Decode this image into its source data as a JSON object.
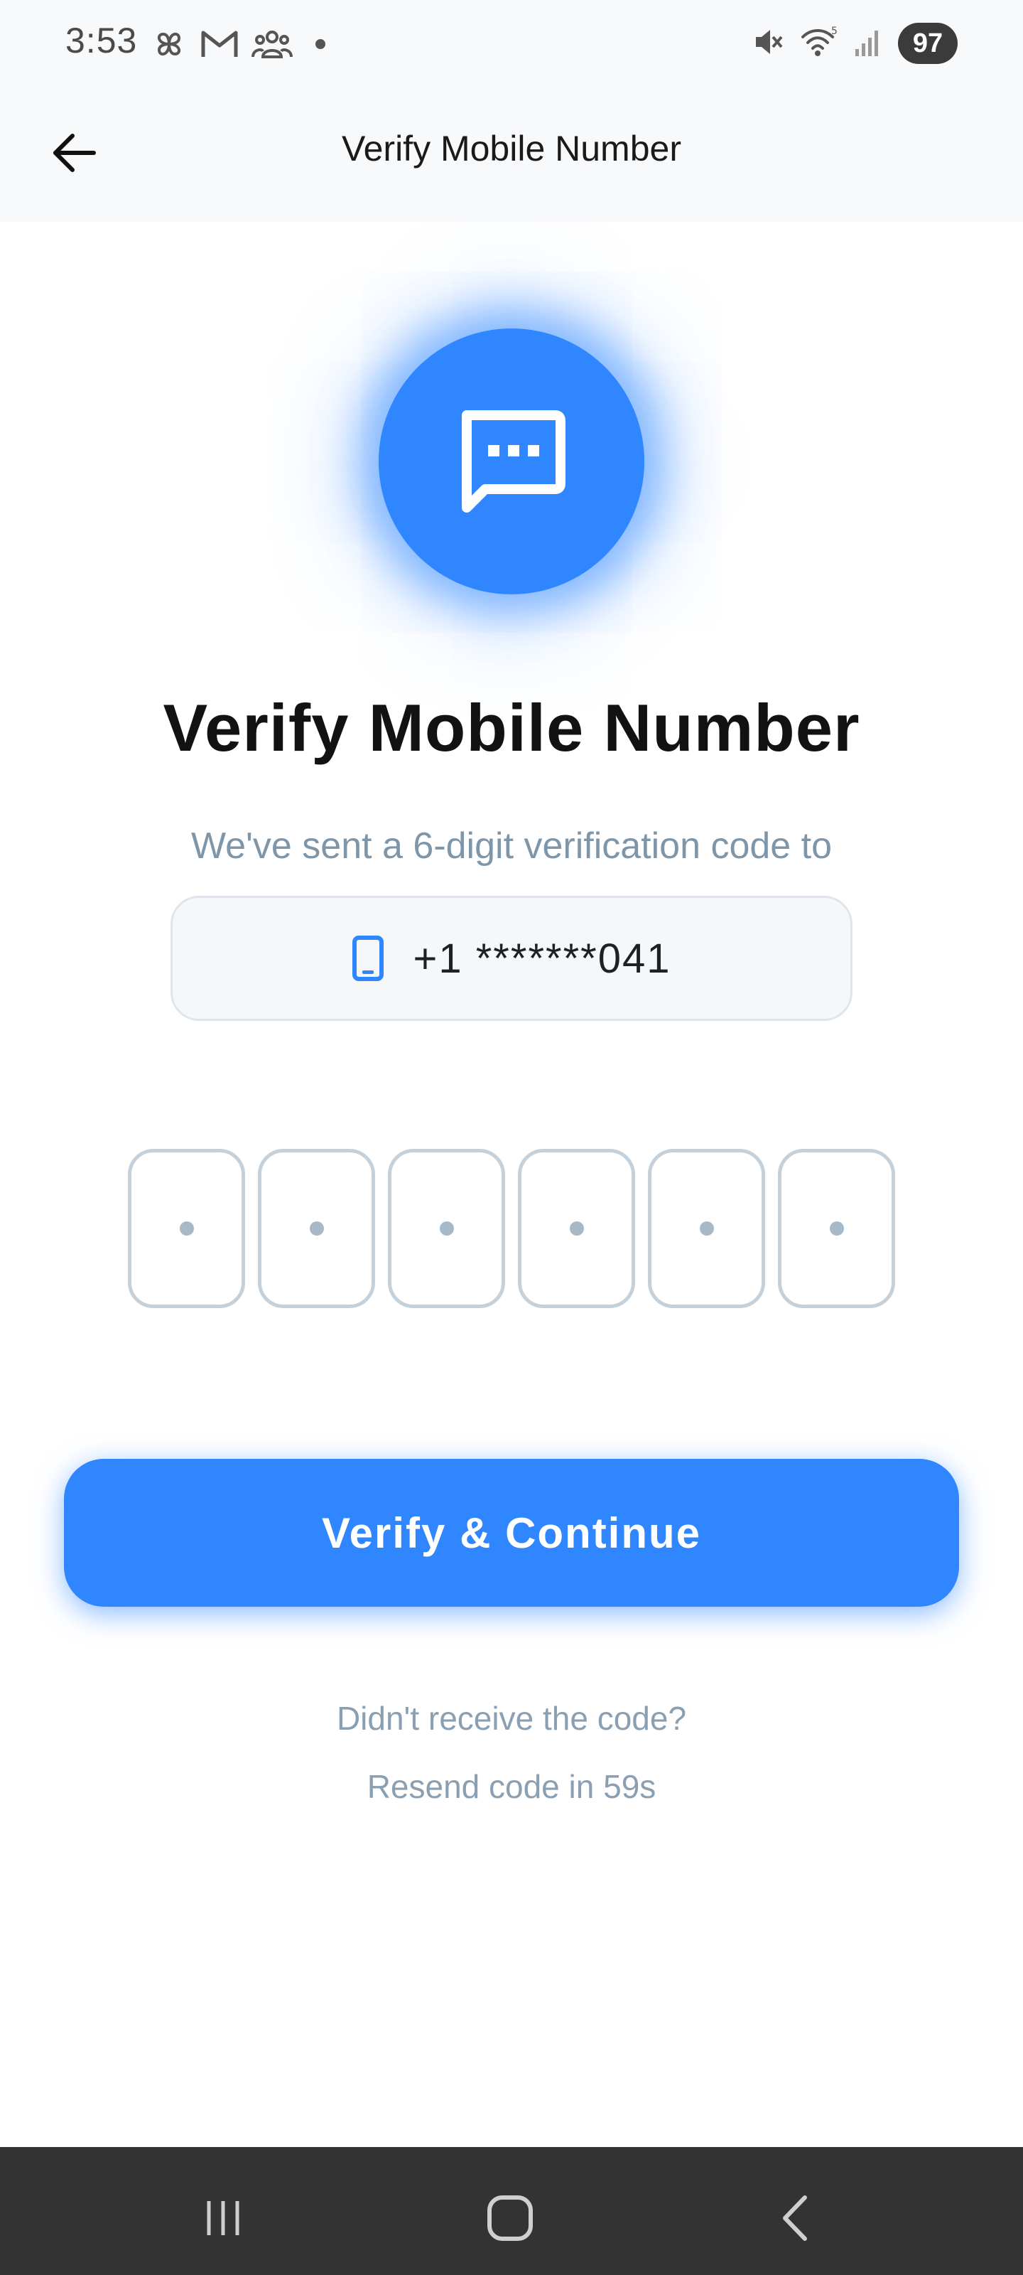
{
  "status_bar": {
    "time": "3:53",
    "left_icons": [
      "pinwheel-icon",
      "gmail-icon",
      "people-icon",
      "dot-icon"
    ],
    "right_icons": [
      "mute-icon",
      "wifi-icon",
      "signal-icon"
    ],
    "wifi_label": "5",
    "battery": "97"
  },
  "header": {
    "back_icon": "arrow-left-icon",
    "title": "Verify Mobile Number"
  },
  "hero": {
    "icon": "chat-bubble-icon",
    "color": "#2f86ff"
  },
  "main": {
    "title": "Verify Mobile Number",
    "subtitle": "We've sent a 6-digit verification code to",
    "phone_icon": "smartphone-icon",
    "phone_number": "+1 *******041",
    "otp_length": 6,
    "otp_placeholder": "•",
    "verify_button": "Verify & Continue",
    "resend_question": "Didn't receive the code?",
    "resend_timer": "Resend code in 59s"
  },
  "nav_bar": {
    "items": [
      "recents-icon",
      "home-icon",
      "back-icon"
    ]
  },
  "colors": {
    "accent": "#2f86ff",
    "muted_text": "#8aa0b2",
    "nav_background": "#333333"
  }
}
